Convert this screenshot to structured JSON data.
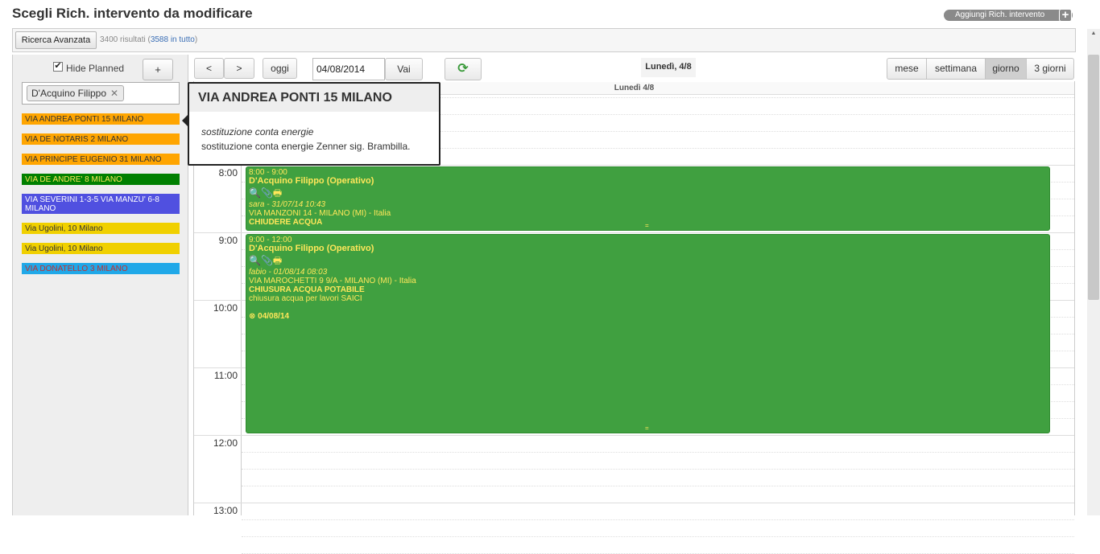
{
  "header": {
    "title": "Scegli Rich. intervento da modificare",
    "add_button": "Aggiungi Rich. intervento",
    "add_plus": "+"
  },
  "search": {
    "advanced_button": "Ricerca Avanzata",
    "results": "3400 risultati (",
    "total_link": "3588 in tutto",
    "results_end": ")"
  },
  "sidebar": {
    "hide_planned_label": "Hide Planned",
    "hide_planned_checked": "✔",
    "add_button": "+",
    "tag": "D'Acquino Filippo",
    "tag_remove": "✕",
    "jobs": [
      {
        "label": "VIA ANDREA PONTI 15 MILANO",
        "bg": "#ffa500",
        "fg": "#333333"
      },
      {
        "label": "VIA DE NOTARIS 2 MILANO",
        "bg": "#ffa500",
        "fg": "#333333"
      },
      {
        "label": "VIA PRINCIPE EUGENIO 31 MILANO",
        "bg": "#ffa500",
        "fg": "#333333"
      },
      {
        "label": "VIA DE ANDRE' 8 MILANO",
        "bg": "#008000",
        "fg": "#ffe75a"
      },
      {
        "label": "VIA SEVERINI 1-3-5 VIA MANZU' 6-8 MILANO",
        "bg": "#5050e0",
        "fg": "#ffffff"
      },
      {
        "label": "Via Ugolini, 10 Milano",
        "bg": "#f0d000",
        "fg": "#333333"
      },
      {
        "label": "Via Ugolini, 10 Milano",
        "bg": "#f0d000",
        "fg": "#333333"
      },
      {
        "label": "VIA DONATELLO 3 MILANO",
        "bg": "#20a8e8",
        "fg": "#c03030"
      }
    ]
  },
  "toolbar": {
    "prev": "<",
    "next": ">",
    "today": "oggi",
    "date_value": "04/08/2014",
    "go": "Vai",
    "refresh_icon": "⟳",
    "day_title": "Lunedì, 4/8",
    "views": [
      "mese",
      "settimana",
      "giorno",
      "3 giorni"
    ],
    "active_view": "giorno"
  },
  "calendar": {
    "column_header": "Lunedì 4/8",
    "hours": [
      "8:00",
      "9:00",
      "10:00",
      "11:00",
      "12:00",
      "13:00"
    ],
    "events": [
      {
        "time": "8:00 - 9:00",
        "who": "D'Acquino Filippo (Operativo)",
        "icons": "🔍📎🖶",
        "author": "sara - 31/07/14 10:43",
        "address": "VIA MANZONI 14 - MILANO (MI) - Italia",
        "subject": "CHIUDERE ACQUA",
        "note": "",
        "date_line": "",
        "grip": "="
      },
      {
        "time": "9:00 - 12:00",
        "who": "D'Acquino Filippo (Operativo)",
        "icons": "🔍📎🖶",
        "author": "fabio - 01/08/14 08:03",
        "address": "VIA MAROCHETTI 9 9/A - MILANO (MI) - Italia",
        "subject": "CHIUSURA ACQUA POTABILE",
        "note": "chiusura acqua per lavori SAICI",
        "date_line": "⊗ 04/08/14",
        "grip": "="
      }
    ]
  },
  "tooltip": {
    "title": "VIA ANDREA PONTI 15 MILANO",
    "subtitle": "sostituzione conta energie",
    "description": "sostituzione conta energie Zenner sig. Brambilla."
  },
  "colors": {
    "event_bg": "#40a040",
    "event_text": "#ffe75a"
  }
}
